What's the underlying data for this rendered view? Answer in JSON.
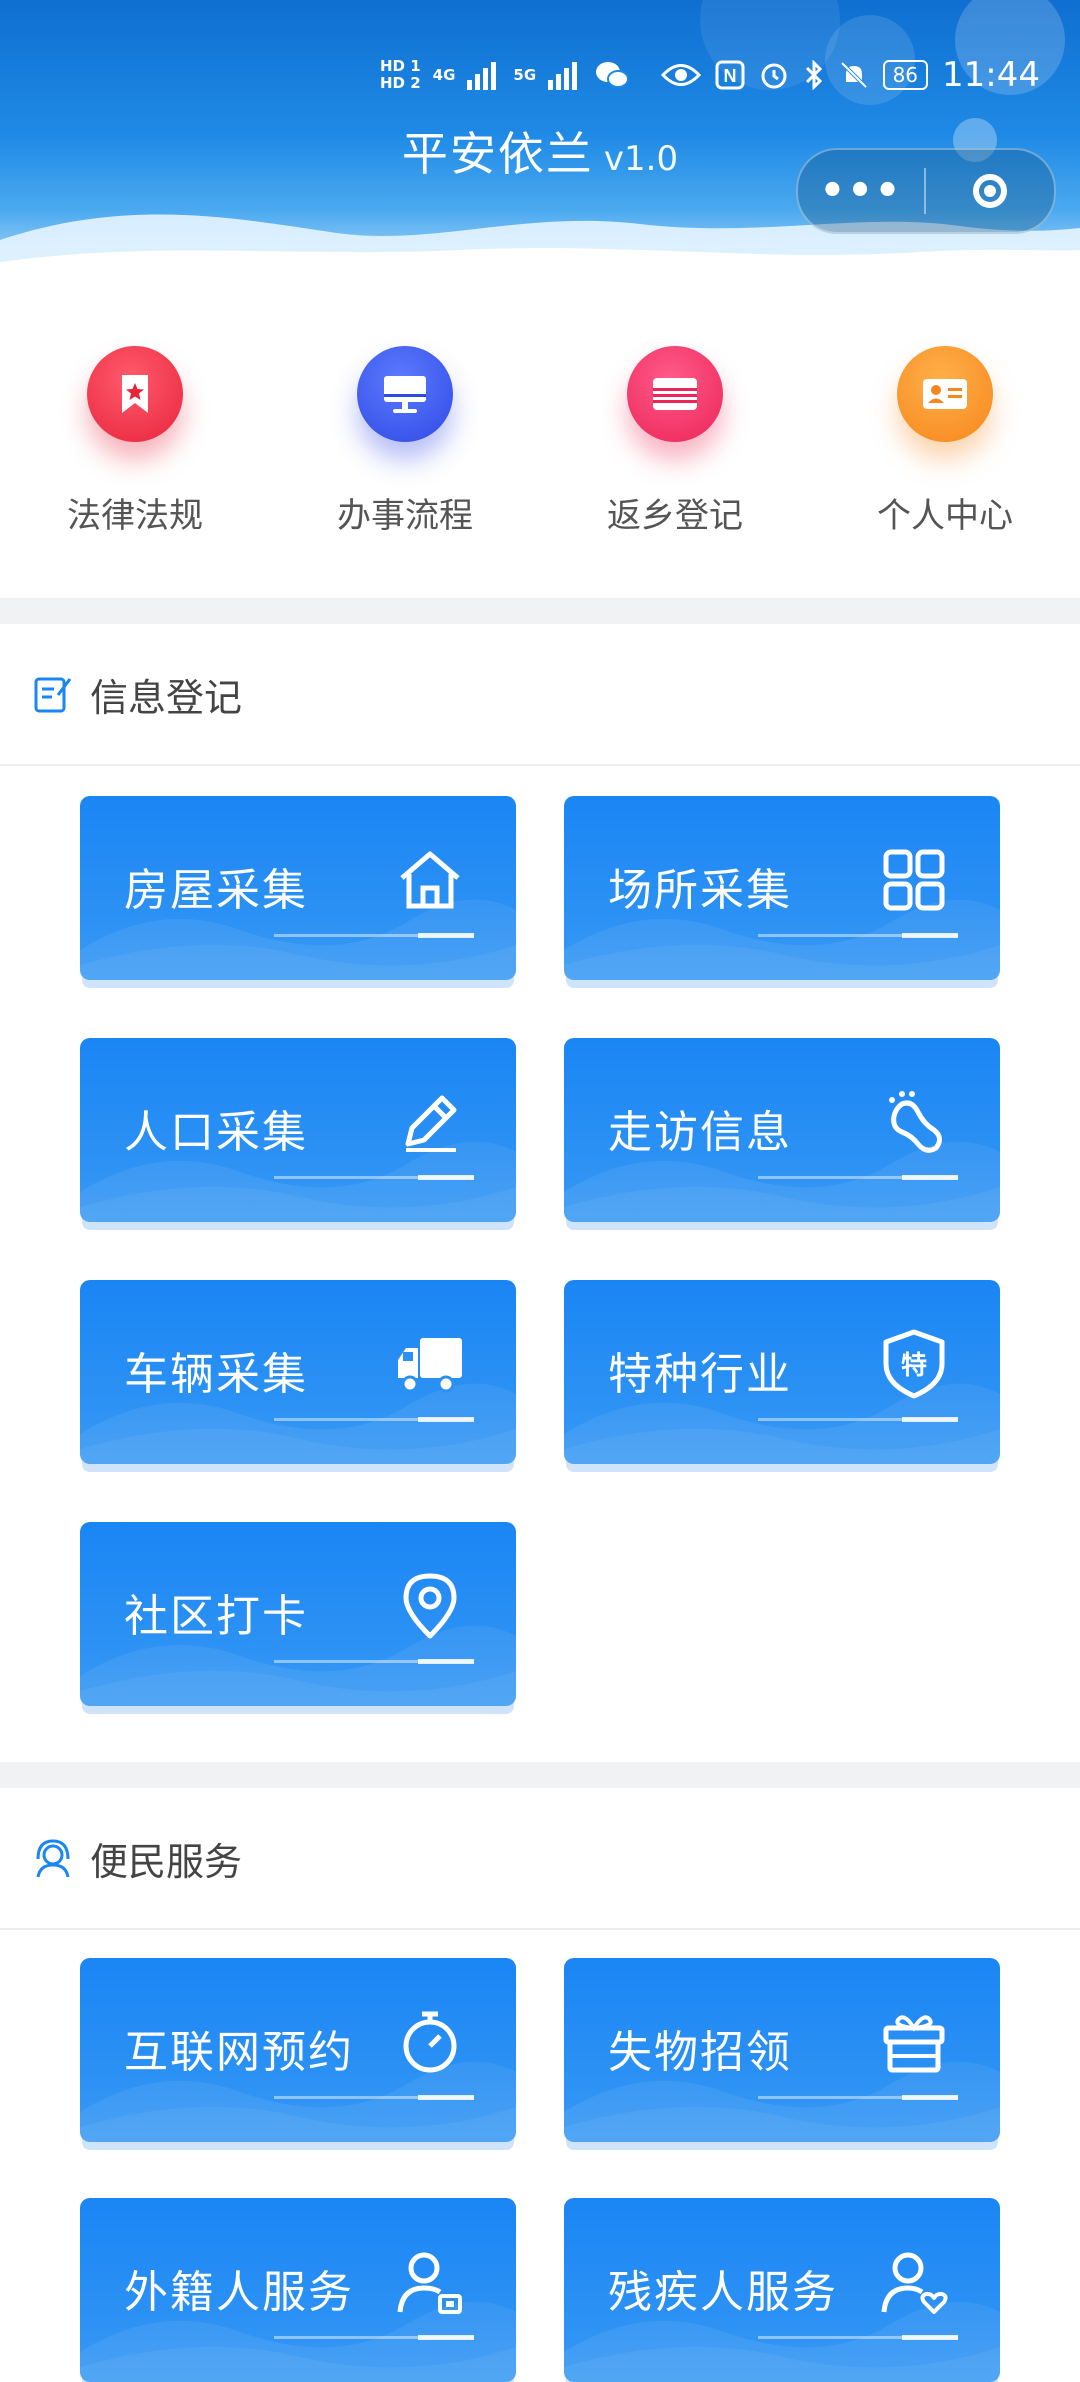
{
  "status_bar": {
    "hd1": "HD 1",
    "hd2": "HD 2",
    "net1": "4G",
    "net2": "5G",
    "battery": "86",
    "time": "11:44"
  },
  "app": {
    "name": "平安依兰",
    "version": "v1.0"
  },
  "quick_nav": [
    {
      "label": "法律法规",
      "icon": "bookmark-star-icon",
      "color": "#e8243c"
    },
    {
      "label": "办事流程",
      "icon": "monitor-icon",
      "color": "#3049e4"
    },
    {
      "label": "返乡登记",
      "icon": "card-icon",
      "color": "#ec2457"
    },
    {
      "label": "个人中心",
      "icon": "id-card-icon",
      "color": "#f7861c"
    }
  ],
  "sections": {
    "registration": {
      "title": "信息登记",
      "cards": [
        {
          "label": "房屋采集",
          "icon": "house-icon"
        },
        {
          "label": "场所采集",
          "icon": "grid-icon"
        },
        {
          "label": "人口采集",
          "icon": "pencil-icon"
        },
        {
          "label": "走访信息",
          "icon": "footprint-icon"
        },
        {
          "label": "车辆采集",
          "icon": "truck-icon"
        },
        {
          "label": "特种行业",
          "icon": "shield-icon",
          "icon_text": "特"
        },
        {
          "label": "社区打卡",
          "icon": "location-pin-icon"
        }
      ]
    },
    "services": {
      "title": "便民服务",
      "cards": [
        {
          "label": "互联网预约",
          "icon": "stopwatch-icon"
        },
        {
          "label": "失物招领",
          "icon": "gift-icon"
        },
        {
          "label": "外籍人服务",
          "icon": "user-card-icon"
        },
        {
          "label": "残疾人服务",
          "icon": "user-heart-icon"
        }
      ]
    }
  },
  "colors": {
    "accent": "#1a86f4",
    "section_icon": "#1a86f4"
  }
}
